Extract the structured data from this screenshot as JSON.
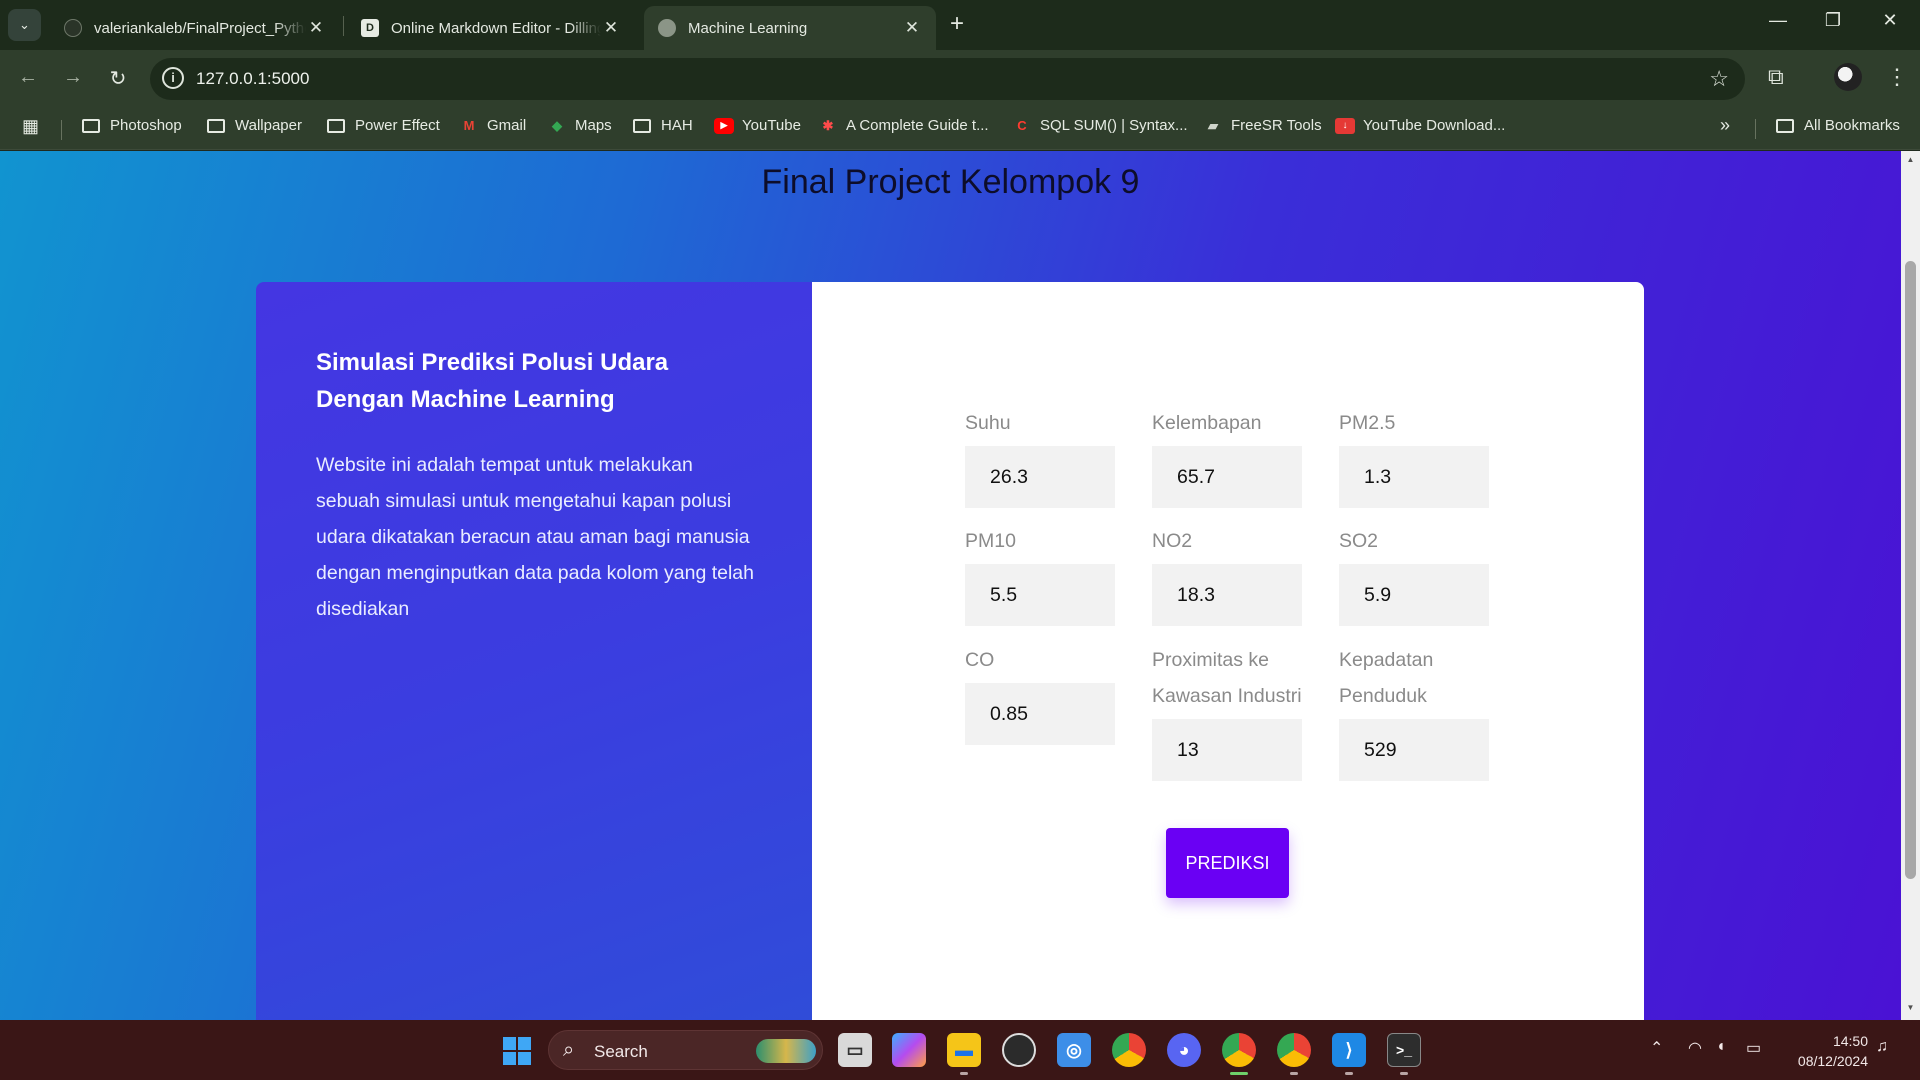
{
  "browser": {
    "tabs": [
      {
        "title": "valeriankaleb/FinalProject_Python",
        "favicon": "github-icon"
      },
      {
        "title": "Online Markdown Editor - Dillinger",
        "favicon": "dillinger-icon",
        "favicon_letter": "D"
      },
      {
        "title": "Machine Learning",
        "favicon": "globe-icon",
        "active": true
      }
    ],
    "new_tab": "+",
    "url": "127.0.0.1:5000",
    "bookmarks": [
      {
        "label": "Photoshop",
        "icon": "folder-icon"
      },
      {
        "label": "Wallpaper",
        "icon": "folder-icon"
      },
      {
        "label": "Power Effect",
        "icon": "folder-icon"
      },
      {
        "label": "Gmail",
        "icon": "gmail-icon"
      },
      {
        "label": "Maps",
        "icon": "maps-icon"
      },
      {
        "label": "HAH",
        "icon": "folder-icon"
      },
      {
        "label": "YouTube",
        "icon": "youtube-icon"
      },
      {
        "label": "A Complete Guide t...",
        "icon": "guide-icon"
      },
      {
        "label": "SQL SUM() | Syntax...",
        "icon": "sql-icon"
      },
      {
        "label": "FreeSR Tools",
        "icon": "freesr-icon"
      },
      {
        "label": "YouTube Download...",
        "icon": "download-icon"
      }
    ],
    "more_bookmarks": "»",
    "all_bookmarks": "All Bookmarks"
  },
  "page": {
    "title": "Final Project Kelompok 9",
    "heading": "Simulasi Prediksi Polusi Udara Dengan Machine Learning",
    "description": "Website ini adalah tempat untuk melakukan sebuah simulasi untuk mengetahui kapan polusi udara dikatakan beracun atau aman bagi manusia dengan menginputkan data pada kolom yang telah disediakan",
    "fields": {
      "suhu": {
        "label": "Suhu",
        "value": "26.3"
      },
      "kelembapan": {
        "label": "Kelembapan",
        "value": "65.7"
      },
      "pm25": {
        "label": "PM2.5",
        "value": "1.3"
      },
      "pm10": {
        "label": "PM10",
        "value": "5.5"
      },
      "no2": {
        "label": "NO2",
        "value": "18.3"
      },
      "so2": {
        "label": "SO2",
        "value": "5.9"
      },
      "co": {
        "label": "CO",
        "value": "0.85"
      },
      "proximitas": {
        "label": "Proximitas ke Kawasan Industri",
        "value": "13"
      },
      "kepadatan": {
        "label": "Kepadatan Penduduk",
        "value": "529"
      }
    },
    "predict_button": "PREDIKSI"
  },
  "taskbar": {
    "search": "Search",
    "time": "14:50",
    "date": "08/12/2024",
    "apps": [
      "task-view-icon",
      "copilot-icon",
      "file-explorer-icon",
      "obs-icon",
      "app-icon",
      "chrome-icon",
      "discord-icon",
      "chrome-profile-icon",
      "chrome-icon",
      "vscode-icon",
      "terminal-icon"
    ]
  },
  "colors": {
    "accent": "#6a00f4",
    "page_gradient_start": "#1194d0",
    "page_gradient_end": "#4a12d4",
    "card_left": "#3b3de0"
  }
}
